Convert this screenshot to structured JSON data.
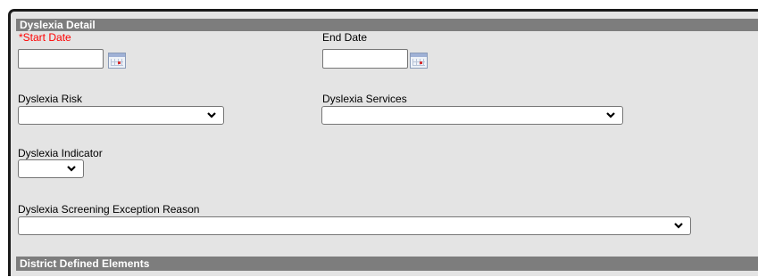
{
  "sections": {
    "dyslexia_detail": "Dyslexia Detail",
    "district_defined": "District Defined Elements"
  },
  "fields": {
    "start_date": {
      "required_mark": "*",
      "label": "Start Date",
      "value": ""
    },
    "end_date": {
      "label": "End Date",
      "value": ""
    },
    "dyslexia_risk": {
      "label": "Dyslexia Risk",
      "value": ""
    },
    "dyslexia_services": {
      "label": "Dyslexia Services",
      "value": ""
    },
    "dyslexia_indicator": {
      "label": "Dyslexia Indicator",
      "value": ""
    },
    "screening_exception_reason": {
      "label": "Dyslexia Screening Exception Reason",
      "value": ""
    }
  },
  "icons": {
    "calendar": "calendar-icon",
    "dropdown": "chevron-down-icon"
  },
  "colors": {
    "required": "#ff0000",
    "section_header": "#7d7d7d",
    "panel_background": "#e4e4e4"
  }
}
